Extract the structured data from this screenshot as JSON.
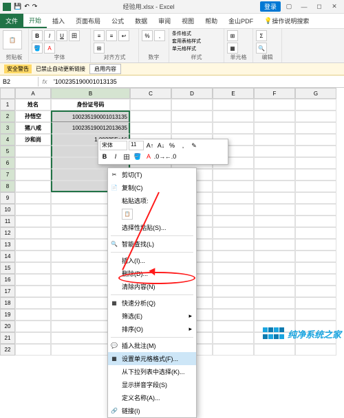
{
  "titlebar": {
    "filename": "经验用.xlsx - Excel",
    "login": "登录"
  },
  "tabs": [
    "文件",
    "开始",
    "插入",
    "页面布局",
    "公式",
    "数据",
    "审阅",
    "视图",
    "帮助",
    "金山PDF",
    "操作说明搜索"
  ],
  "active_tab": "开始",
  "ribbon_groups": [
    "剪贴板",
    "字体",
    "对齐方式",
    "数字",
    "样式",
    "单元格",
    "编辑"
  ],
  "ribbon_style_items": [
    "条件格式",
    "套用表格样式",
    "单元格样式"
  ],
  "security": {
    "badge": "安全警告",
    "msg": "已禁止自动更新链接",
    "btn": "启用内容"
  },
  "namebox": "B2",
  "formula": "'100235190001013135",
  "columns": [
    "A",
    "B",
    "C",
    "D",
    "E",
    "F",
    "G"
  ],
  "headers": {
    "a": "姓名",
    "b": "身份证号码"
  },
  "rows": [
    {
      "n": 2,
      "a": "孙悟空",
      "b": "100235190001013135"
    },
    {
      "n": 3,
      "a": "猪八戒",
      "b": "100235190012013635"
    },
    {
      "n": 4,
      "a": "沙和尚",
      "b": "1.00235E+16"
    }
  ],
  "mini": {
    "font": "宋体",
    "size": "11"
  },
  "context_menu": {
    "cut": "剪切(T)",
    "copy": "复制(C)",
    "paste_opts": "粘贴选项:",
    "paste_special": "选择性粘贴(S)...",
    "smart_lookup": "智能查找(L)",
    "insert": "插入(I)...",
    "delete": "删除(D)...",
    "clear": "清除内容(N)",
    "quick_analysis": "快速分析(Q)",
    "filter": "筛选(E)",
    "sort": "排序(O)",
    "insert_comment": "插入批注(M)",
    "format_cells": "设置单元格格式(F)...",
    "dropdown": "从下拉列表中选择(K)...",
    "phonetic": "显示拼音字段(S)",
    "define_name": "定义名称(A)...",
    "link": "链接(I)"
  },
  "watermark": "纯净系统之家"
}
